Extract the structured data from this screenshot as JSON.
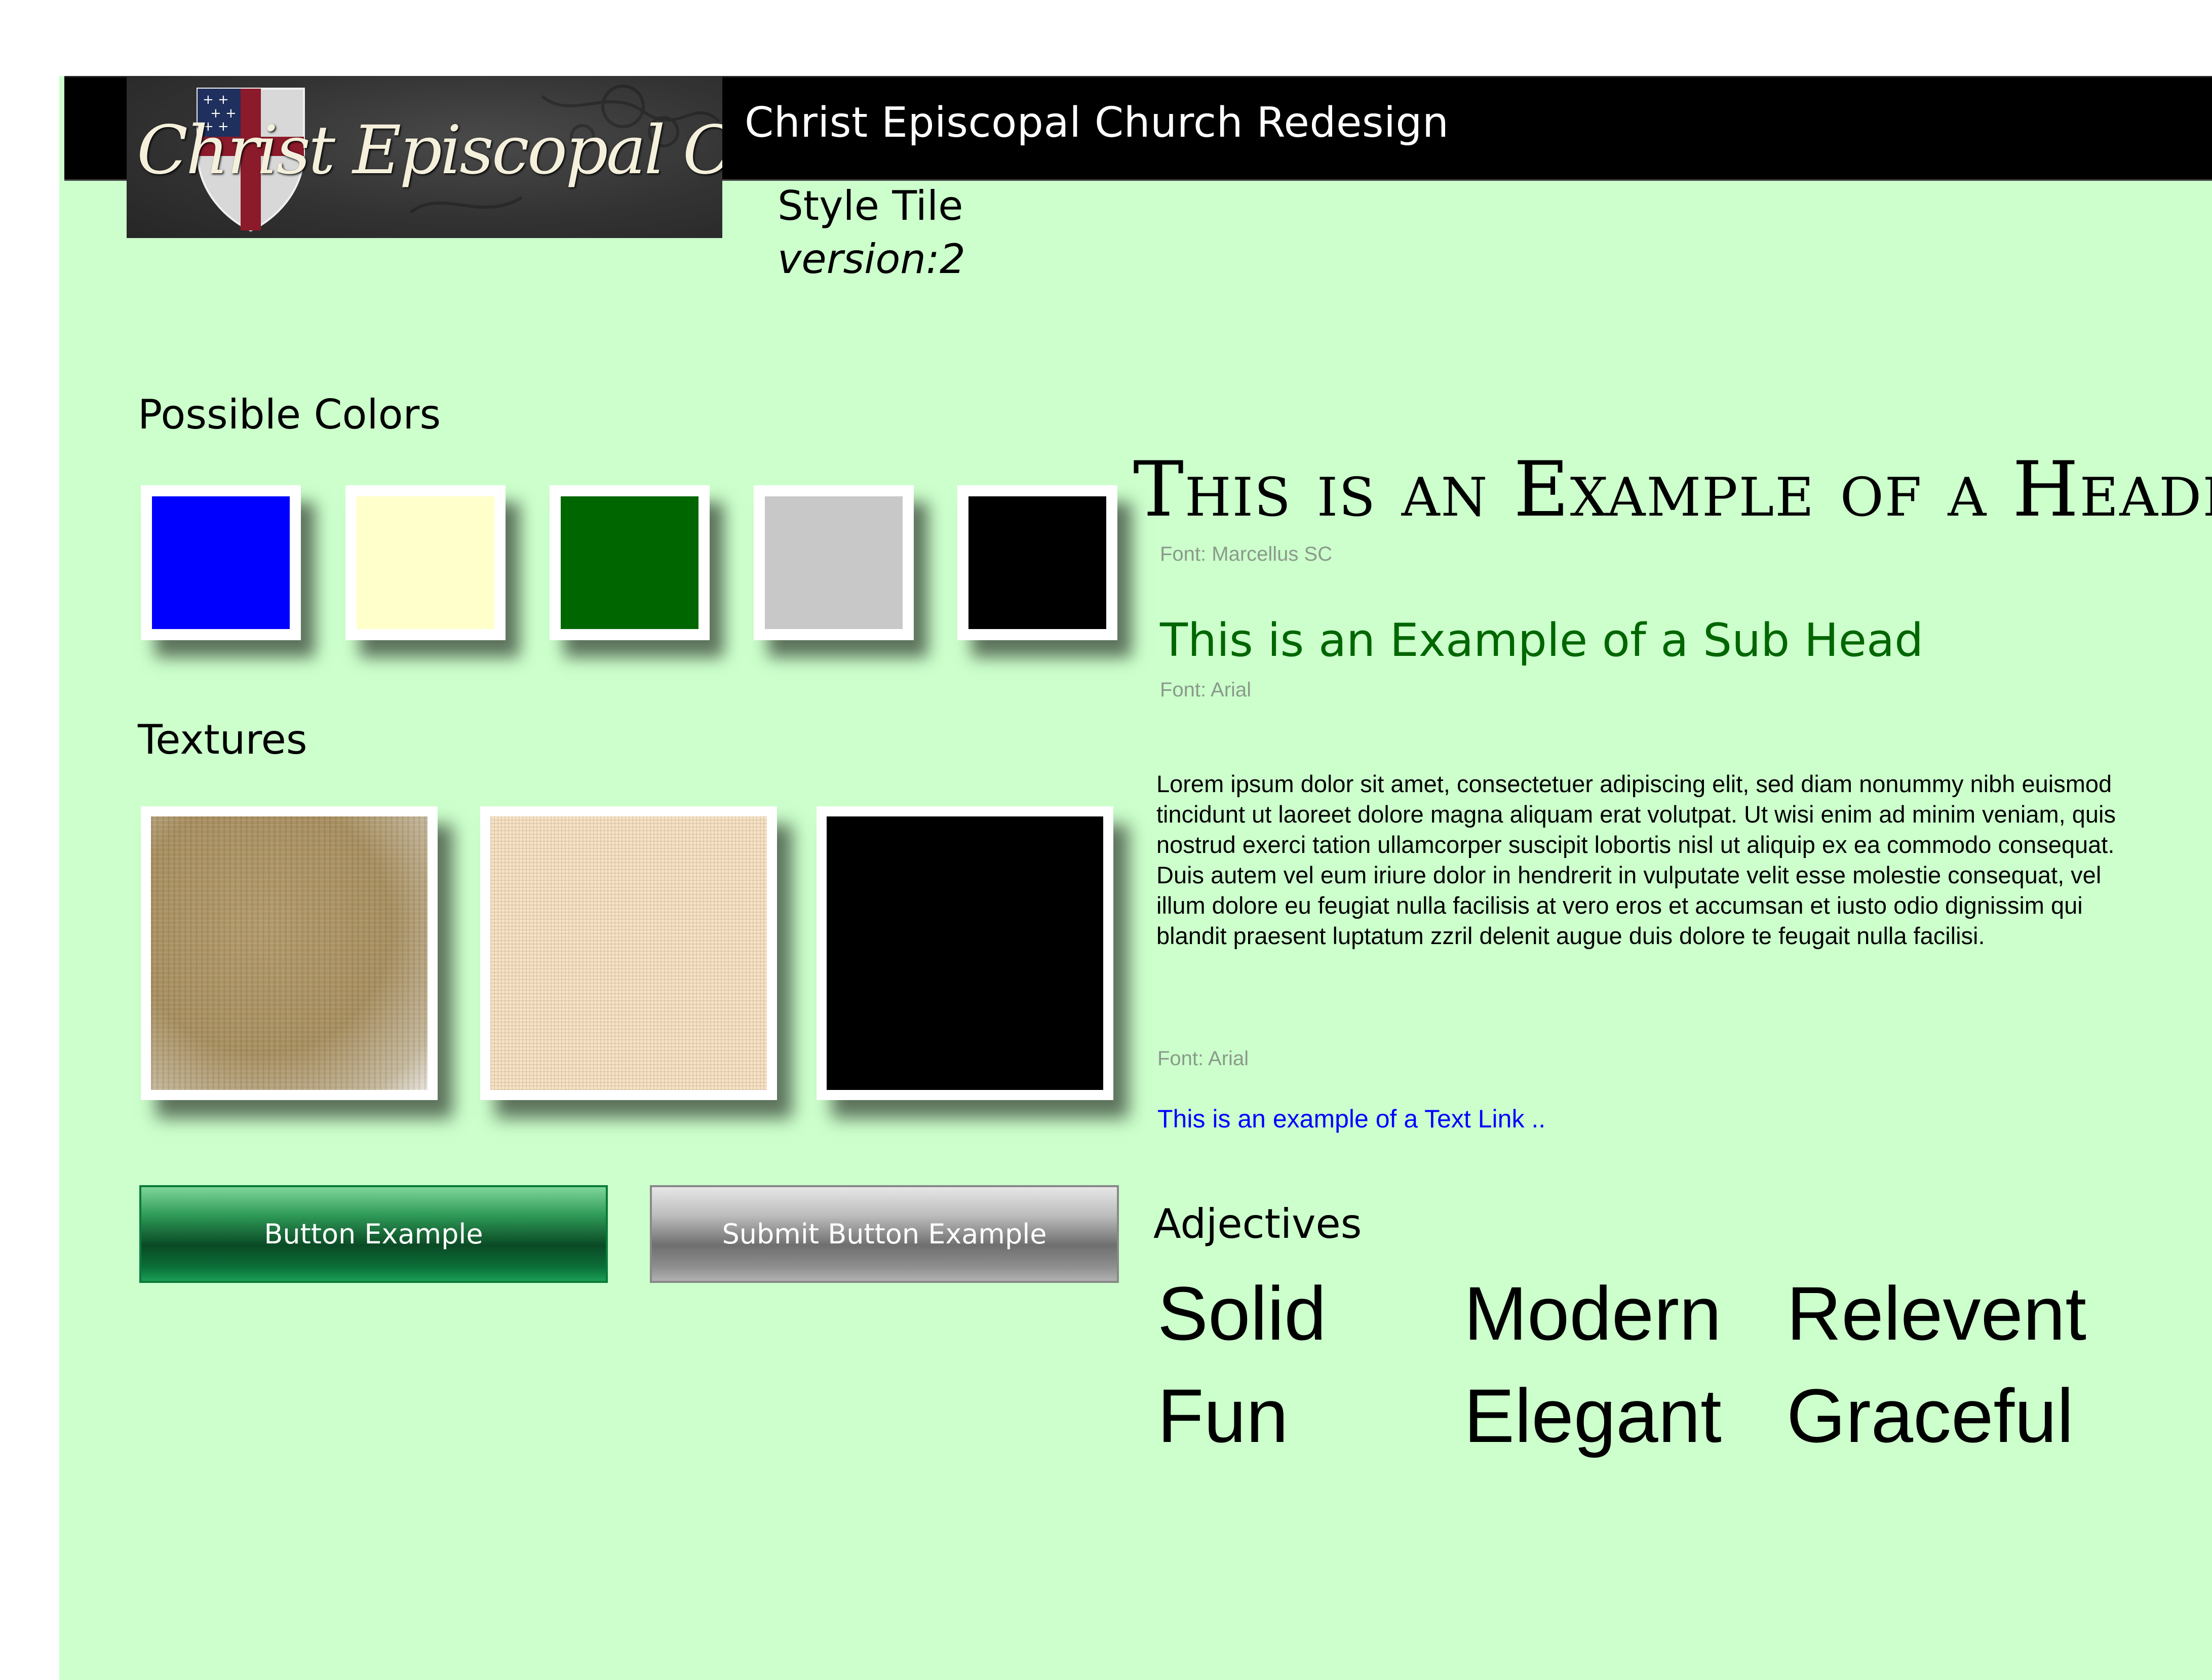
{
  "header": {
    "logo_text": "Christ Episcopal Church",
    "title": "Christ Episcopal Church Redesign"
  },
  "tile": {
    "title": "Style Tile",
    "version": "version:2"
  },
  "colors": {
    "label": "Possible Colors",
    "swatches": [
      "#0000ff",
      "#ffffcc",
      "#006600",
      "#c8c8c8",
      "#000000"
    ]
  },
  "textures": {
    "label": "Textures"
  },
  "buttons": {
    "primary": "Button Example",
    "submit": "Submit Button Example"
  },
  "typography": {
    "header": "This is an Example of a Header",
    "header_font": "Font: Marcellus SC",
    "subhead": "This is an Example of a Sub Head",
    "subhead_font": "Font: Arial",
    "body": "Lorem ipsum dolor sit amet, consectetuer adipiscing elit, sed diam nonummy nibh euismod tincidunt ut laoreet dolore magna aliquam erat volutpat. Ut wisi enim ad minim veniam, quis nostrud exerci tation ullamcorper suscipit lobortis nisl ut aliquip ex ea commodo consequat. Duis autem vel eum iriure dolor in hendrerit in vulputate velit esse molestie consequat, vel illum dolore eu feugiat nulla facilisis at vero eros et accumsan et iusto odio dignissim qui blandit praesent luptatum zzril delenit augue duis dolore te feugait nulla facilisi.",
    "body_font": "Font: Arial",
    "link": "This is an example of a Text Link .."
  },
  "adjectives": {
    "label": "Adjectives",
    "words": [
      "Solid",
      "Modern",
      "Relevent",
      "Fun",
      "Elegant",
      "Graceful"
    ]
  }
}
